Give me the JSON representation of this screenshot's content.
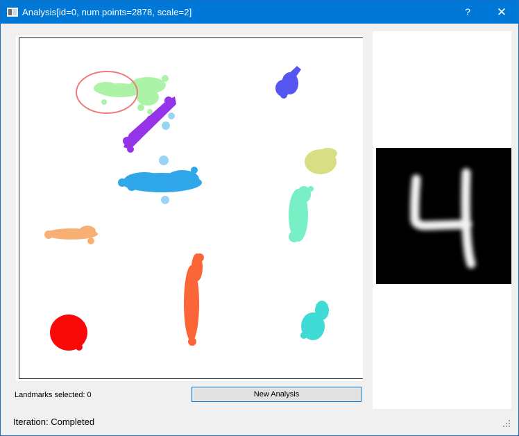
{
  "window": {
    "title": "Analysis[id=0, num points=2878, scale=2]",
    "help_glyph": "?",
    "close_glyph": "✕"
  },
  "controls": {
    "landmarks_label": "Landmarks selected: 0",
    "new_analysis_label": "New Analysis"
  },
  "status": {
    "text": "Iteration: Completed"
  },
  "selected_digit": "4",
  "colors": {
    "accent": "#0078d7",
    "selection_ring": "#ee7b7b"
  },
  "icons": {
    "app": "app-window-icon",
    "help": "help-icon",
    "close": "close-icon",
    "grip": "size-grip-icon"
  }
}
